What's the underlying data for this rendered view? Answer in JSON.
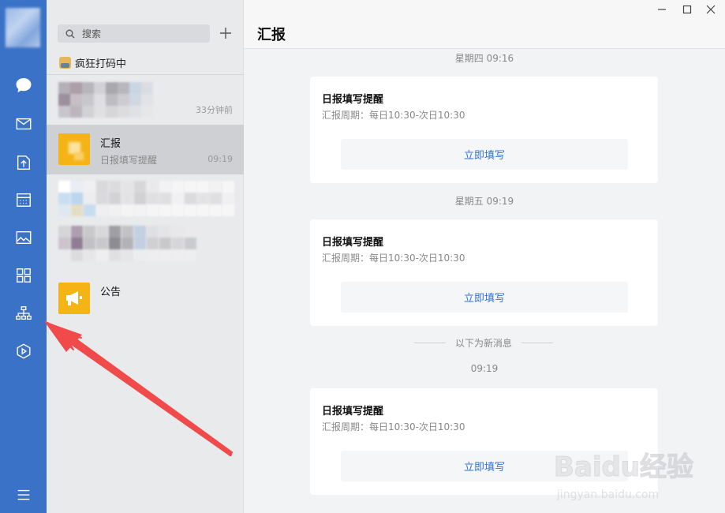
{
  "window": {
    "title": "汇报"
  },
  "search": {
    "placeholder": "搜索"
  },
  "user_status": {
    "text": "疯狂打码中"
  },
  "conversations": [
    {
      "name": "",
      "preview": "",
      "time": "33分钟前"
    },
    {
      "name": "汇报",
      "preview": "日报填写提醒",
      "time": "09:19"
    },
    {
      "name": "",
      "preview": "",
      "time": ""
    },
    {
      "name": "",
      "preview": "",
      "time": ""
    },
    {
      "name": "公告",
      "preview": "",
      "time": ""
    }
  ],
  "messages": [
    {
      "timestamp": "星期四 09:16",
      "title": "日报填写提醒",
      "subtitle": "汇报周期：每日10:30-次日10:30",
      "button": "立即填写"
    },
    {
      "timestamp": "星期五 09:19",
      "title": "日报填写提醒",
      "subtitle": "汇报周期：每日10:30-次日10:30",
      "button": "立即填写"
    },
    {
      "timestamp": "09:19",
      "title": "日报填写提醒",
      "subtitle": "汇报周期：每日10:30-次日10:30",
      "button": "立即填写"
    }
  ],
  "new_message_divider": "以下为新消息",
  "watermark": {
    "brand": "Baidu经验",
    "url": "jingyan.baidu.com"
  },
  "colors": {
    "rail": "#3a72c7",
    "accent": "#2f74d0",
    "announce": "#f5b416",
    "arrow": "#f04a4a"
  }
}
